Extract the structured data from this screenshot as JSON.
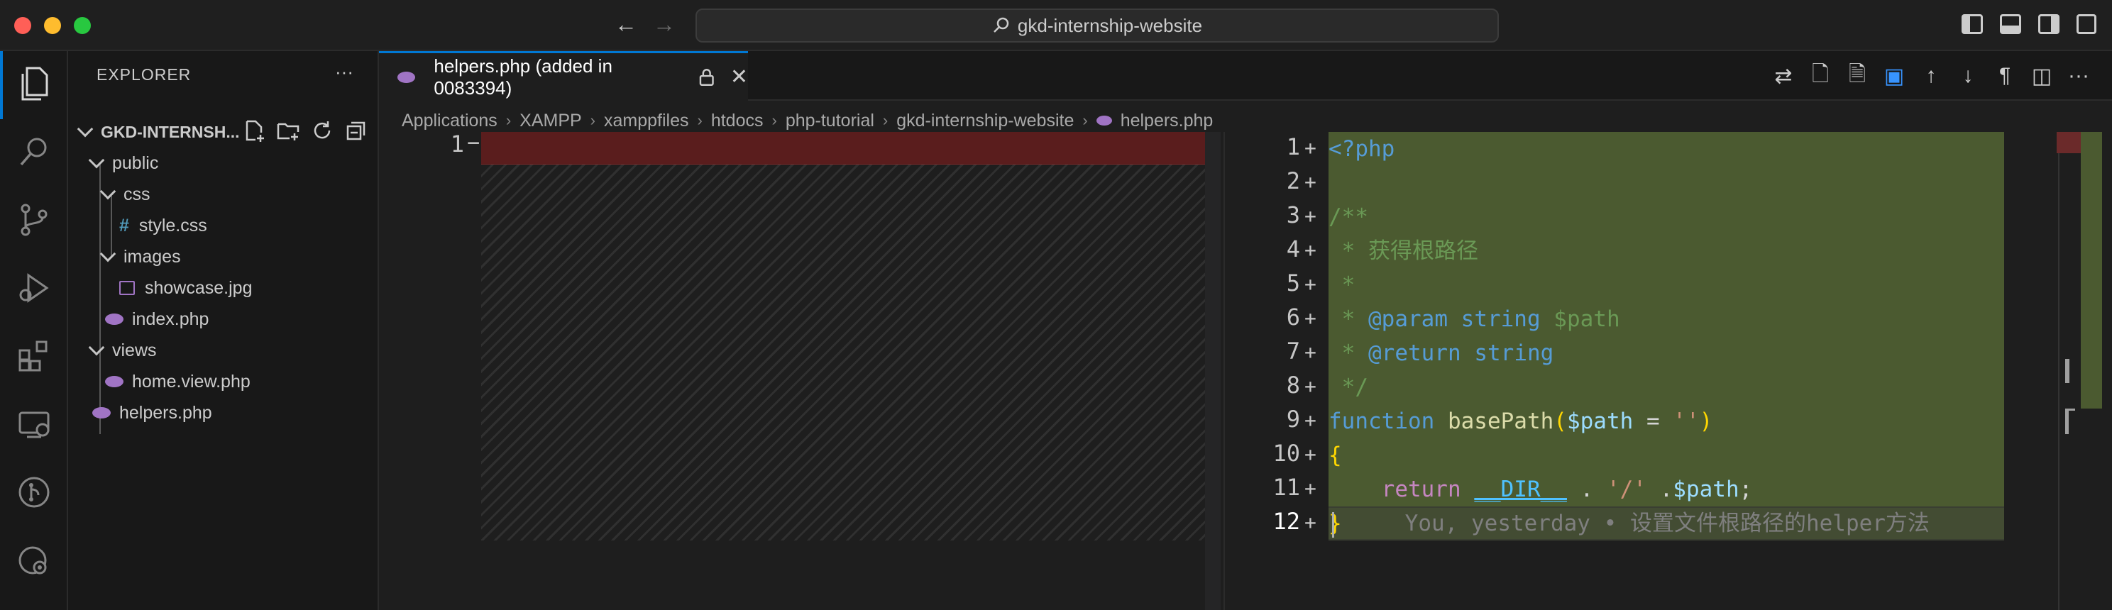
{
  "window": {
    "search_text": "gkd-internship-website"
  },
  "sidebar": {
    "title": "EXPLORER",
    "more": "···",
    "root": "GKD-INTERNSH...",
    "tree": [
      {
        "label": "public",
        "kind": "folder",
        "depth": 1
      },
      {
        "label": "css",
        "kind": "folder",
        "depth": 2
      },
      {
        "label": "style.css",
        "kind": "css",
        "depth": 3,
        "icon": "#"
      },
      {
        "label": "images",
        "kind": "folder",
        "depth": 2
      },
      {
        "label": "showcase.jpg",
        "kind": "image",
        "depth": 3
      },
      {
        "label": "index.php",
        "kind": "php",
        "depth": 2
      },
      {
        "label": "views",
        "kind": "folder",
        "depth": 1
      },
      {
        "label": "home.view.php",
        "kind": "php",
        "depth": 2
      },
      {
        "label": "helpers.php",
        "kind": "php",
        "depth": 1
      }
    ]
  },
  "tab": {
    "title": "helpers.php (added in 0083394)"
  },
  "breadcrumb": [
    "Applications",
    "XAMPP",
    "xamppfiles",
    "htdocs",
    "php-tutorial",
    "gkd-internship-website",
    "helpers.php"
  ],
  "diff": {
    "left_line_number": "1",
    "left_marker": "−",
    "right_lines": [
      {
        "n": "1",
        "m": "+",
        "tokens": [
          [
            "<?php",
            "kw"
          ]
        ]
      },
      {
        "n": "2",
        "m": "+",
        "tokens": []
      },
      {
        "n": "3",
        "m": "+",
        "tokens": [
          [
            "/**",
            "cm"
          ]
        ]
      },
      {
        "n": "4",
        "m": "+",
        "tokens": [
          [
            " * 获得根路径",
            "cm"
          ]
        ]
      },
      {
        "n": "5",
        "m": "+",
        "tokens": [
          [
            " *",
            "cm"
          ]
        ]
      },
      {
        "n": "6",
        "m": "+",
        "tokens": [
          [
            " * ",
            "cm"
          ],
          [
            "@param",
            "doc"
          ],
          [
            " ",
            "cm"
          ],
          [
            "string",
            "doc"
          ],
          [
            " $path",
            "cm"
          ]
        ]
      },
      {
        "n": "7",
        "m": "+",
        "tokens": [
          [
            " * ",
            "cm"
          ],
          [
            "@return",
            "doc"
          ],
          [
            " ",
            "cm"
          ],
          [
            "string",
            "doc"
          ]
        ]
      },
      {
        "n": "8",
        "m": "+",
        "tokens": [
          [
            " */",
            "cm"
          ]
        ]
      },
      {
        "n": "9",
        "m": "+",
        "tokens": [
          [
            "function",
            "kw"
          ],
          [
            " ",
            "pl"
          ],
          [
            "basePath",
            "fn"
          ],
          [
            "(",
            "br"
          ],
          [
            "$path",
            "var"
          ],
          [
            " = ",
            "pl"
          ],
          [
            "''",
            "str"
          ],
          [
            ")",
            "br"
          ]
        ]
      },
      {
        "n": "10",
        "m": "+",
        "tokens": [
          [
            "{",
            "br"
          ]
        ]
      },
      {
        "n": "11",
        "m": "+",
        "tokens": [
          [
            "    ",
            "pl"
          ],
          [
            "return",
            "ret"
          ],
          [
            " ",
            "pl"
          ],
          [
            "__DIR__",
            "const"
          ],
          [
            " . ",
            "pl"
          ],
          [
            "'/'",
            "str"
          ],
          [
            " .",
            "pl"
          ],
          [
            "$path",
            "var"
          ],
          [
            ";",
            "pl"
          ]
        ]
      },
      {
        "n": "12",
        "m": "+",
        "tokens": [
          [
            "}",
            "br"
          ]
        ]
      }
    ],
    "blame": "You, yesterday • 设置文件根路径的helper方法"
  },
  "colors": {
    "kw": "#569cd6",
    "cm": "#6a9955",
    "doc": "#569cd6",
    "fn": "#dcdcaa",
    "var": "#9cdcfe",
    "str": "#ce9178",
    "br": "#ffd700",
    "ret": "#c586c0",
    "const": "#4fc1ff",
    "pl": "#d4d4d4"
  }
}
